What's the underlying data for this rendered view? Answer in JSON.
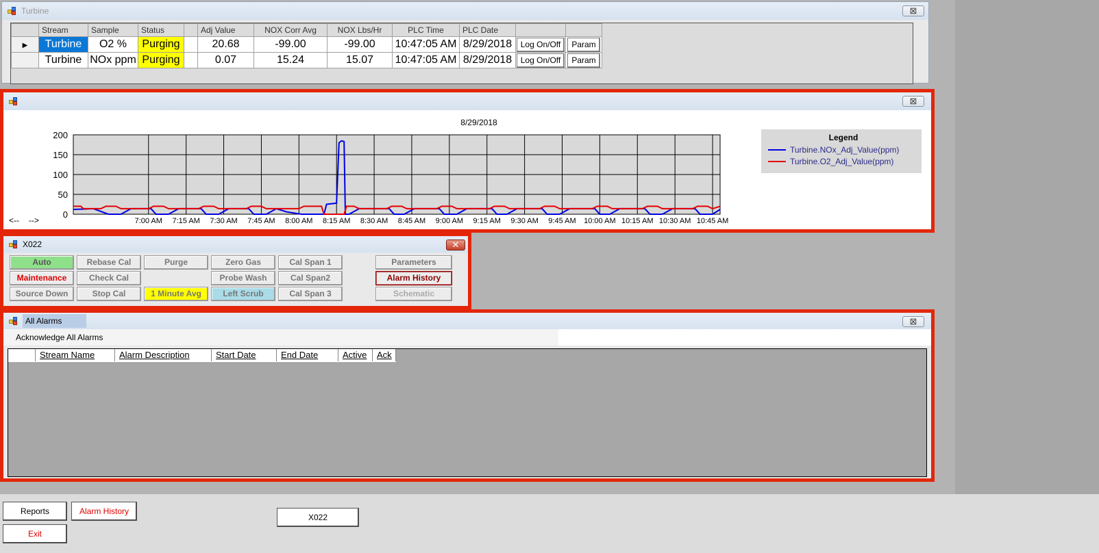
{
  "turbine_window": {
    "title": "Turbine",
    "columns": [
      "Stream",
      "Sample",
      "Status",
      "Adj Value",
      "NOX Corr Avg",
      "NOX Lbs/Hr",
      "PLC Time",
      "PLC Date"
    ],
    "rows": [
      {
        "stream": "Turbine",
        "sample": "O2 %",
        "status": "Purging",
        "adj_value": "20.68",
        "nox_corr_avg": "-99.00",
        "nox_lbs_hr": "-99.00",
        "plc_time": "10:47:05 AM",
        "plc_date": "8/29/2018",
        "log_label": "Log On/Off",
        "param_label": "Param"
      },
      {
        "stream": "Turbine",
        "sample": "NOx ppm",
        "status": "Purging",
        "adj_value": "0.07",
        "nox_corr_avg": "15.24",
        "nox_lbs_hr": "15.07",
        "plc_time": "10:47:05 AM",
        "plc_date": "8/29/2018",
        "log_label": "Log On/Off",
        "param_label": "Param"
      }
    ]
  },
  "chart_window": {
    "close": "⊠",
    "nav_left": "<--",
    "nav_right": "-->"
  },
  "chart_data": {
    "type": "line",
    "title": "8/29/2018",
    "xlabel": "",
    "ylabel": "",
    "x_ticks": [
      "7:00 AM",
      "7:15 AM",
      "7:30 AM",
      "7:45 AM",
      "8:00 AM",
      "8:15 AM",
      "8:30 AM",
      "8:45 AM",
      "9:00 AM",
      "9:15 AM",
      "9:30 AM",
      "9:45 AM",
      "10:00 AM",
      "10:15 AM",
      "10:30 AM",
      "10:45 AM"
    ],
    "y_ticks": [
      0,
      50,
      100,
      150,
      200
    ],
    "ylim": [
      0,
      200
    ],
    "xlim_minutes": [
      390,
      648
    ],
    "grid": true,
    "legend_title": "Legend",
    "legend_position": "right",
    "series": [
      {
        "name": "Turbine.NOx_Adj_Value(ppm)",
        "color": "#0000e6",
        "points": [
          [
            390,
            12
          ],
          [
            398,
            14
          ],
          [
            404,
            0
          ],
          [
            409,
            0
          ],
          [
            413,
            14
          ],
          [
            421,
            14
          ],
          [
            423,
            0
          ],
          [
            428,
            0
          ],
          [
            432,
            14
          ],
          [
            441,
            14
          ],
          [
            443,
            0
          ],
          [
            448,
            0
          ],
          [
            452,
            14
          ],
          [
            460,
            14
          ],
          [
            462,
            0
          ],
          [
            467,
            0
          ],
          [
            471,
            14
          ],
          [
            475,
            6
          ],
          [
            481,
            0
          ],
          [
            487,
            0
          ],
          [
            490,
            0
          ],
          [
            491,
            25
          ],
          [
            495,
            28
          ],
          [
            496,
            180
          ],
          [
            497,
            185
          ],
          [
            498,
            183
          ],
          [
            498.5,
            0
          ],
          [
            500,
            0
          ],
          [
            504,
            14
          ],
          [
            516,
            14
          ],
          [
            518,
            0
          ],
          [
            522,
            0
          ],
          [
            526,
            14
          ],
          [
            536,
            14
          ],
          [
            538,
            0
          ],
          [
            543,
            0
          ],
          [
            547,
            14
          ],
          [
            557,
            14
          ],
          [
            559,
            0
          ],
          [
            563,
            0
          ],
          [
            567,
            14
          ],
          [
            577,
            14
          ],
          [
            579,
            0
          ],
          [
            584,
            0
          ],
          [
            588,
            14
          ],
          [
            598,
            14
          ],
          [
            600,
            0
          ],
          [
            604,
            0
          ],
          [
            608,
            14
          ],
          [
            618,
            14
          ],
          [
            620,
            0
          ],
          [
            625,
            0
          ],
          [
            629,
            14
          ],
          [
            638,
            14
          ],
          [
            640,
            0
          ],
          [
            645,
            0
          ],
          [
            648,
            12
          ]
        ]
      },
      {
        "name": "Turbine.O2_Adj_Value(ppm)",
        "color": "#e60000",
        "points": [
          [
            390,
            20
          ],
          [
            393,
            20
          ],
          [
            394,
            14
          ],
          [
            401,
            14
          ],
          [
            403,
            20
          ],
          [
            407,
            20
          ],
          [
            409,
            14
          ],
          [
            420,
            14
          ],
          [
            422,
            20
          ],
          [
            426,
            20
          ],
          [
            428,
            14
          ],
          [
            440,
            14
          ],
          [
            442,
            20
          ],
          [
            446,
            20
          ],
          [
            448,
            14
          ],
          [
            459,
            14
          ],
          [
            461,
            20
          ],
          [
            465,
            20
          ],
          [
            467,
            14
          ],
          [
            480,
            14
          ],
          [
            482,
            20
          ],
          [
            489,
            20
          ],
          [
            490,
            0
          ],
          [
            498,
            0
          ],
          [
            499,
            20
          ],
          [
            502,
            20
          ],
          [
            504,
            14
          ],
          [
            515,
            14
          ],
          [
            517,
            20
          ],
          [
            521,
            20
          ],
          [
            523,
            14
          ],
          [
            535,
            14
          ],
          [
            537,
            20
          ],
          [
            541,
            20
          ],
          [
            543,
            14
          ],
          [
            556,
            14
          ],
          [
            558,
            20
          ],
          [
            562,
            20
          ],
          [
            564,
            14
          ],
          [
            576,
            14
          ],
          [
            578,
            20
          ],
          [
            582,
            20
          ],
          [
            584,
            14
          ],
          [
            597,
            14
          ],
          [
            599,
            20
          ],
          [
            603,
            20
          ],
          [
            605,
            14
          ],
          [
            617,
            14
          ],
          [
            619,
            20
          ],
          [
            623,
            20
          ],
          [
            625,
            14
          ],
          [
            637,
            14
          ],
          [
            639,
            20
          ],
          [
            643,
            20
          ],
          [
            645,
            14
          ],
          [
            648,
            20
          ]
        ]
      }
    ]
  },
  "x022_window": {
    "title": "X022",
    "close": "✕",
    "buttons": {
      "auto": "Auto",
      "rebase_cal": "Rebase Cal",
      "purge": "Purge",
      "zero_gas": "Zero Gas",
      "cal_span_1": "Cal Span 1",
      "parameters": "Parameters",
      "maintenance": "Maintenance",
      "check_cal": "Check Cal",
      "probe_wash": "Probe Wash",
      "cal_span2": "Cal Span2",
      "alarm_history": "Alarm History",
      "source_down": "Source Down",
      "stop_cal": "Stop Cal",
      "one_minute_avg": "1 Minute Avg",
      "left_scrub": "Left Scrub",
      "cal_span_3": "Cal Span 3",
      "schematic": "Schematic"
    }
  },
  "alarms_window": {
    "title": "All Alarms",
    "close": "⊠",
    "ack_all": "Acknowledge All Alarms",
    "columns": [
      "Stream Name",
      "Alarm Description",
      "Start Date",
      "End Date",
      "Active",
      "Ack"
    ]
  },
  "bottom": {
    "reports": "Reports",
    "alarm_history": "Alarm History",
    "exit": "Exit",
    "x022": "X022"
  },
  "turbine_close": "⊠"
}
